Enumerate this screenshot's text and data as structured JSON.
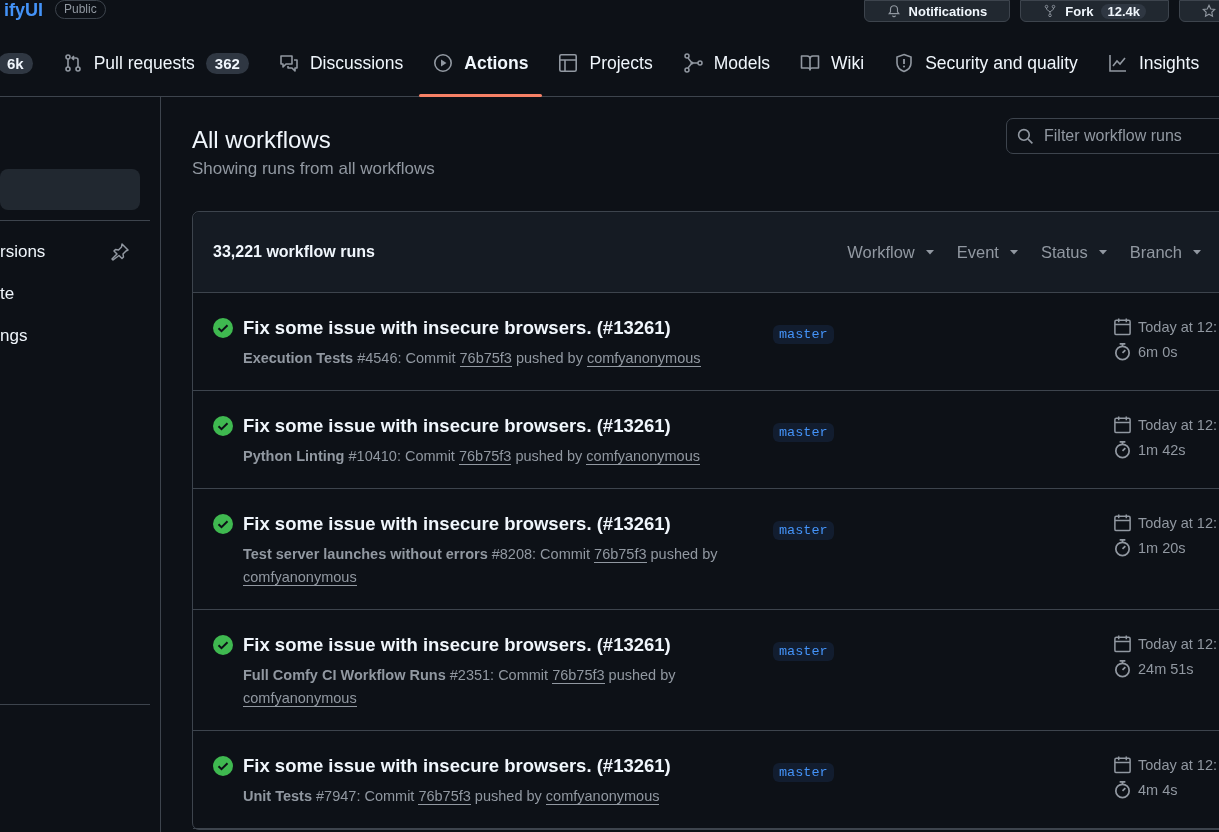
{
  "header": {
    "repo_name": "ifyUI",
    "visibility": "Public",
    "buttons": [
      {
        "label": "Notifications",
        "kind": "bell"
      },
      {
        "label": "Fork",
        "counter": "12.4k",
        "kind": "fork"
      },
      {
        "kind": "star"
      }
    ]
  },
  "tabs": [
    {
      "counter": "6k",
      "kind": "plain",
      "selected": false
    },
    {
      "label": "Pull requests",
      "counter": "362",
      "kind": "pr",
      "selected": false
    },
    {
      "label": "Discussions",
      "kind": "discussion",
      "selected": false
    },
    {
      "label": "Actions",
      "kind": "play",
      "selected": true
    },
    {
      "label": "Projects",
      "kind": "table",
      "selected": false
    },
    {
      "label": "Models",
      "kind": "models",
      "selected": false
    },
    {
      "label": "Wiki",
      "kind": "book",
      "selected": false
    },
    {
      "label": "Security and quality",
      "kind": "shield",
      "selected": false
    },
    {
      "label": "Insights",
      "kind": "graph",
      "selected": false
    }
  ],
  "sidebar": {
    "items": [
      {
        "selected": true
      },
      {
        "label": "rsions",
        "selected": false,
        "pinned": true
      },
      {
        "label": "te",
        "selected": false,
        "pinned": false
      },
      {
        "label": "ngs",
        "selected": false,
        "pinned": false
      }
    ]
  },
  "main": {
    "title": "All workflows",
    "subtitle": "Showing runs from all workflows",
    "filter": {
      "placeholder": "Filter workflow runs"
    }
  },
  "runs_table": {
    "count": "33,221 workflow runs",
    "filters": [
      "Workflow",
      "Event",
      "Status",
      "Branch"
    ],
    "rows": [
      {
        "kind": "success",
        "title": "Fix some issue with insecure browsers. (#13261)",
        "workflow": "Execution Tests",
        "run": "#4546: Commit",
        "commit": "76b75f3",
        "pushed_by": "pushed by",
        "actor": "comfyanonymous",
        "branch": "master",
        "date": "Today at 12:",
        "duration": "6m 0s"
      },
      {
        "kind": "success",
        "title": "Fix some issue with insecure browsers. (#13261)",
        "workflow": "Python Linting",
        "run": "#10410: Commit",
        "commit": "76b75f3",
        "pushed_by": "pushed by",
        "actor": "comfyanonymous",
        "branch": "master",
        "date": "Today at 12:",
        "duration": "1m 42s"
      },
      {
        "kind": "success",
        "title": "Fix some issue with insecure browsers. (#13261)",
        "workflow": "Test server launches without errors",
        "run": "#8208: Commit",
        "commit": "76b75f3",
        "pushed_by": "pushed by",
        "actor": "comfyanonymous",
        "branch": "master",
        "date": "Today at 12:",
        "duration": "1m 20s"
      },
      {
        "kind": "success",
        "title": "Fix some issue with insecure browsers. (#13261)",
        "workflow": "Full Comfy CI Workflow Runs",
        "run": "#2351: Commit",
        "commit": "76b75f3",
        "pushed_by": "pushed by",
        "actor": "comfyanonymous",
        "branch": "master",
        "date": "Today at 12:",
        "duration": "24m 51s"
      },
      {
        "kind": "success",
        "title": "Fix some issue with insecure browsers. (#13261)",
        "workflow": "Unit Tests",
        "run": "#7947: Commit",
        "commit": "76b75f3",
        "pushed_by": "pushed by",
        "actor": "comfyanonymous",
        "branch": "master",
        "date": "Today at 12:",
        "duration": "4m 4s"
      }
    ]
  }
}
